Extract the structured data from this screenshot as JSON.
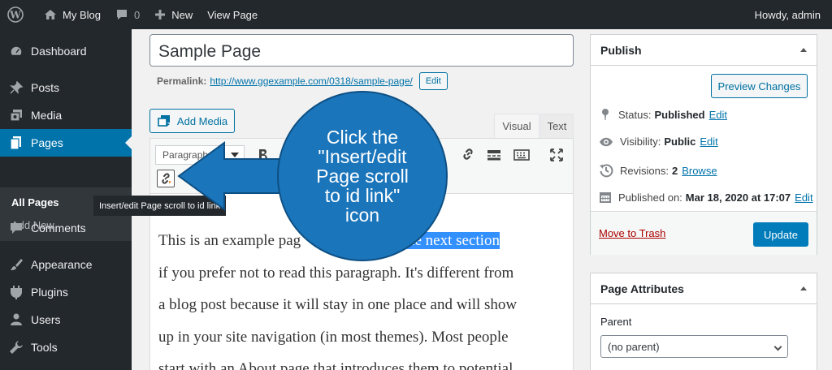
{
  "adminbar": {
    "site_name": "My Blog",
    "comments_count": "0",
    "new_label": "New",
    "view_page_label": "View Page",
    "howdy": "Howdy, admin"
  },
  "sidebar": {
    "items": [
      {
        "label": "Dashboard",
        "icon": "dashboard-icon"
      },
      {
        "label": "Posts",
        "icon": "pushpin-icon"
      },
      {
        "label": "Media",
        "icon": "media-icon"
      },
      {
        "label": "Pages",
        "icon": "pages-icon"
      },
      {
        "label": "Comments",
        "icon": "comment-icon"
      },
      {
        "label": "Appearance",
        "icon": "paintbrush-icon"
      },
      {
        "label": "Plugins",
        "icon": "plugin-icon"
      },
      {
        "label": "Users",
        "icon": "users-icon"
      },
      {
        "label": "Tools",
        "icon": "wrench-icon"
      }
    ],
    "submenu": [
      "All Pages",
      "Add New"
    ]
  },
  "editor": {
    "title": "Sample Page",
    "permalink_label": "Permalink:",
    "permalink_url": "http://www.ggexample.com/0318/sample-page/",
    "permalink_edit": "Edit",
    "add_media": "Add Media",
    "tab_visual": "Visual",
    "tab_text": "Text",
    "format_select": "Paragraph",
    "tooltip": "Insert/edit Page scroll to id link",
    "content_lines": [
      "This is an example pag",
      "to the next section",
      "if you prefer not to read this paragraph. It's different from",
      "a blog post because it will stay in one place and will show",
      "up in your site navigation (in most themes). Most people",
      "start with an About page that introduces them to potential"
    ]
  },
  "publish": {
    "title": "Publish",
    "preview": "Preview Changes",
    "status_label": "Status:",
    "status_value": "Published",
    "visibility_label": "Visibility:",
    "visibility_value": "Public",
    "revisions_label": "Revisions:",
    "revisions_value": "2",
    "browse": "Browse",
    "published_label": "Published on:",
    "published_value": "Mar 18, 2020 at 17:07",
    "edit": "Edit",
    "trash": "Move to Trash",
    "update": "Update"
  },
  "attributes": {
    "title": "Page Attributes",
    "parent_label": "Parent",
    "parent_value": "(no parent)"
  },
  "callout": {
    "text": "Click the \"Insert/edit Page scroll to id link\" icon",
    "lines": [
      "Click the",
      "\"Insert/edit",
      "Page scroll",
      "to id link\"",
      "icon"
    ],
    "color": "#1b75bb"
  }
}
